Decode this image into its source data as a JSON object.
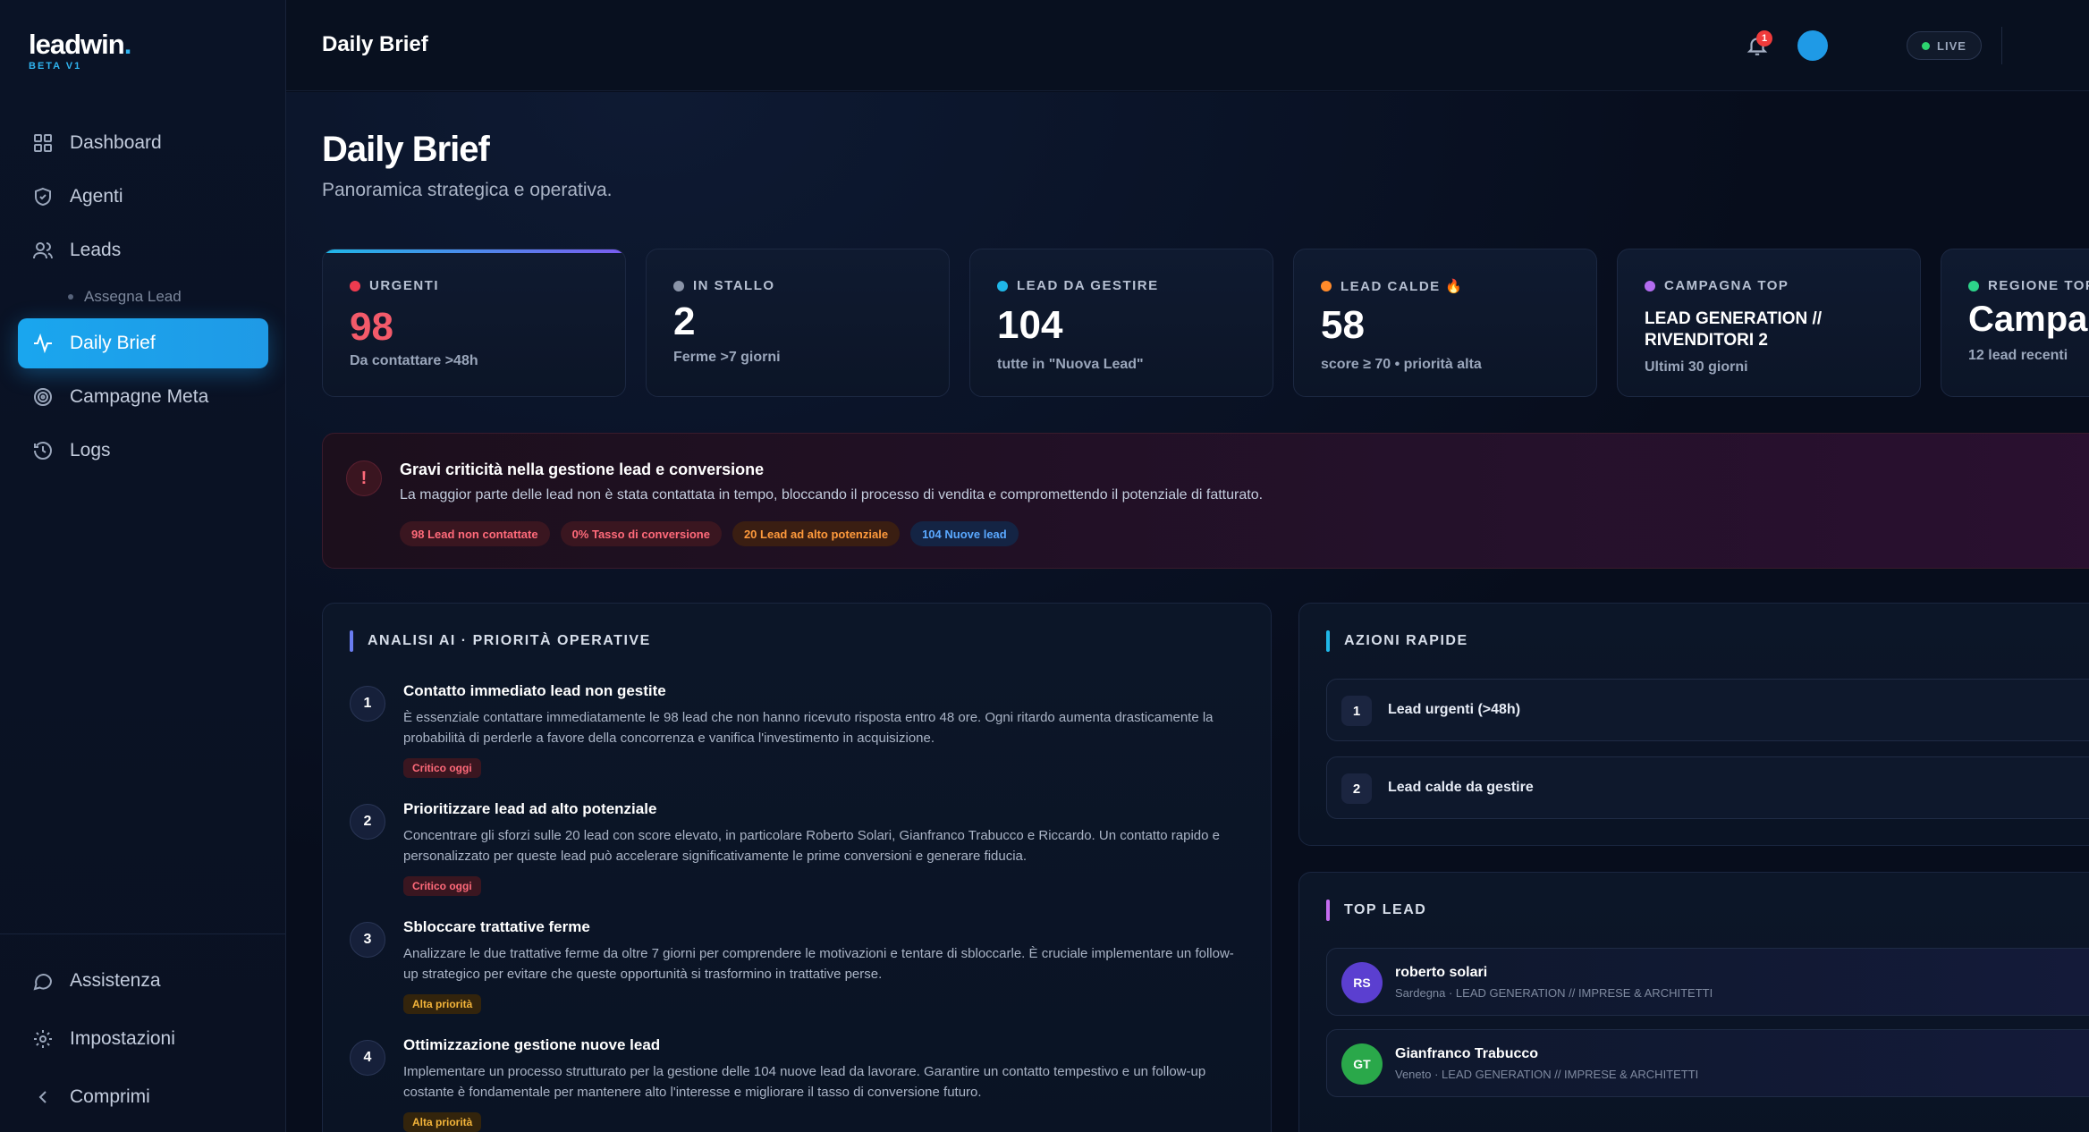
{
  "brand": {
    "name": "leadwin",
    "dot": ".",
    "badge": "BETA V1"
  },
  "sidebar": {
    "items": [
      {
        "label": "Dashboard"
      },
      {
        "label": "Agenti"
      },
      {
        "label": "Leads"
      },
      {
        "label": "Assegna Lead"
      },
      {
        "label": "Daily Brief"
      },
      {
        "label": "Campagne Meta"
      },
      {
        "label": "Logs"
      }
    ],
    "bottom": [
      {
        "label": "Assistenza"
      },
      {
        "label": "Impostazioni"
      },
      {
        "label": "Comprimi"
      }
    ]
  },
  "header": {
    "title": "Daily Brief",
    "live": "LIVE",
    "notifications": "1"
  },
  "page": {
    "title": "Daily Brief",
    "subtitle": "Panoramica strategica e operativa."
  },
  "stats": [
    {
      "label": "URGENTI",
      "value": "98",
      "note": "Da contattare >48h",
      "color": "#ef3b4f"
    },
    {
      "label": "IN STALLO",
      "value": "2",
      "note": "Ferme >7 giorni",
      "color": "#8a94a8"
    },
    {
      "label": "LEAD DA GESTIRE",
      "value": "104",
      "note": "tutte in \"Nuova Lead\"",
      "color": "#1fb7e8"
    },
    {
      "label": "LEAD CALDE 🔥",
      "value": "58",
      "note": "score ≥ 70 • priorità alta",
      "color": "#ff8a2a"
    },
    {
      "label": "CAMPAGNA TOP",
      "value": "LEAD GENERATION // RIVENDITORI 2",
      "note": "Ultimi 30 giorni",
      "color": "#b36cf0"
    },
    {
      "label": "REGIONE TOP",
      "value": "Campa",
      "note": "12 lead recenti",
      "color": "#2dd38a"
    }
  ],
  "alert": {
    "icon": "!",
    "title": "Gravi criticità nella gestione lead e conversione",
    "text": "La maggior parte delle lead non è stata contattata in tempo, bloccando il processo di vendita e compromettendo il potenziale di fatturato.",
    "tags": [
      "98 Lead non contattate",
      "0% Tasso di conversione",
      "20 Lead ad alto potenziale",
      "104 Nuove lead"
    ]
  },
  "analysis": {
    "title": "ANALISI AI · PRIORITÀ OPERATIVE",
    "items": [
      {
        "num": "1",
        "title": "Contatto immediato lead non gestite",
        "text": "È essenziale contattare immediatamente le 98 lead che non hanno ricevuto risposta entro 48 ore. Ogni ritardo aumenta drasticamente la probabilità di perderle a favore della concorrenza e vanifica l'investimento in acquisizione.",
        "tag": "Critico oggi"
      },
      {
        "num": "2",
        "title": "Prioritizzare lead ad alto potenziale",
        "text": "Concentrare gli sforzi sulle 20 lead con score elevato, in particolare Roberto Solari, Gianfranco Trabucco e Riccardo. Un contatto rapido e personalizzato per queste lead può accelerare significativamente le prime conversioni e generare fiducia.",
        "tag": "Critico oggi"
      },
      {
        "num": "3",
        "title": "Sbloccare trattative ferme",
        "text": "Analizzare le due trattative ferme da oltre 7 giorni per comprendere le motivazioni e tentare di sbloccarle. È cruciale implementare un follow-up strategico per evitare che queste opportunità si trasformino in trattative perse.",
        "tag": "Alta priorità"
      },
      {
        "num": "4",
        "title": "Ottimizzazione gestione nuove lead",
        "text": "Implementare un processo strutturato per la gestione delle 104 nuove lead da lavorare. Garantire un contatto tempestivo e un follow-up costante è fondamentale per mantenere alto l'interesse e migliorare il tasso di conversione futuro.",
        "tag": "Alta priorità"
      }
    ]
  },
  "quick_actions": {
    "title": "AZIONI RAPIDE",
    "items": [
      {
        "num": "1",
        "label": "Lead urgenti (>48h)"
      },
      {
        "num": "2",
        "label": "Lead calde da gestire"
      }
    ]
  },
  "top_lead": {
    "title": "TOP LEAD",
    "items": [
      {
        "initials": "RS",
        "name": "roberto solari",
        "meta": "Sardegna · LEAD GENERATION // IMPRESE & ARCHITETTI",
        "color": "#5b3fd0"
      },
      {
        "initials": "GT",
        "name": "Gianfranco Trabucco",
        "meta": "Veneto · LEAD GENERATION // IMPRESE & ARCHITETTI",
        "color": "#2aa84a"
      }
    ]
  }
}
